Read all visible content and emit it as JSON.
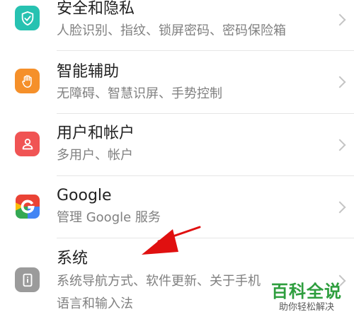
{
  "settings": {
    "items": [
      {
        "title": "安全和隐私",
        "subtitle": "人脸识别、指纹、锁屏密码、密码保险箱",
        "icon": "shield-check-icon",
        "color": "#27c2b1"
      },
      {
        "title": "智能辅助",
        "subtitle": "无障碍、智慧识屏、手势控制",
        "icon": "hand-icon",
        "color": "#f5902a"
      },
      {
        "title": "用户和帐户",
        "subtitle": "多用户、帐户",
        "icon": "user-icon",
        "color": "#f05454"
      },
      {
        "title": "Google",
        "subtitle": "管理 Google 服务",
        "icon": "google-icon",
        "color": "#4285f4"
      },
      {
        "title": "系统",
        "subtitle_line1": "系统导航方式、软件更新、关于手机",
        "subtitle_line2": "语言和输入法",
        "icon": "phone-info-icon",
        "color": "#9b9b9b"
      }
    ]
  },
  "watermark": {
    "line1": "百科全说",
    "line2": "助你轻松解决"
  },
  "annotation": {
    "type": "arrow",
    "color": "#e01010",
    "points_to": "系统"
  }
}
